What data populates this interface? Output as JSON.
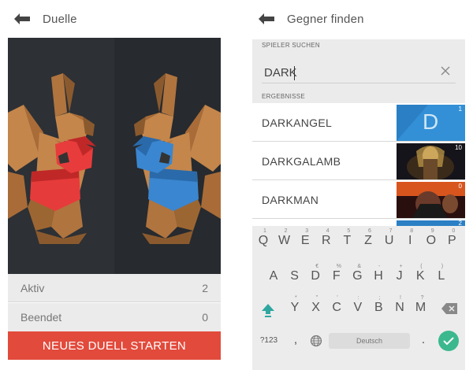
{
  "left_screen": {
    "title": "Duelle",
    "stats": [
      {
        "label": "Aktiv",
        "value": "2"
      },
      {
        "label": "Beendet",
        "value": "0"
      }
    ],
    "start_button": "NEUES DUELL STARTEN"
  },
  "right_screen": {
    "title": "Gegner finden",
    "search_section": "SPIELER SUCHEN",
    "search_value": "DARK",
    "results_section": "ERGEBNISSE",
    "results": [
      {
        "name": "DARKANGEL",
        "count": "1",
        "avatar_letter": "D"
      },
      {
        "name": "DARKGALAMB",
        "count": "10"
      },
      {
        "name": "DARKMAN",
        "count": "0"
      },
      {
        "name": "",
        "count": "2"
      }
    ]
  },
  "keyboard": {
    "row1": [
      {
        "k": "Q",
        "s": "1"
      },
      {
        "k": "W",
        "s": "2"
      },
      {
        "k": "E",
        "s": "3"
      },
      {
        "k": "R",
        "s": "4"
      },
      {
        "k": "T",
        "s": "5"
      },
      {
        "k": "Z",
        "s": "6"
      },
      {
        "k": "U",
        "s": "7"
      },
      {
        "k": "I",
        "s": "8"
      },
      {
        "k": "O",
        "s": "9"
      },
      {
        "k": "P",
        "s": "0"
      }
    ],
    "row2": [
      {
        "k": "A",
        "s": ""
      },
      {
        "k": "S",
        "s": ""
      },
      {
        "k": "D",
        "s": "€"
      },
      {
        "k": "F",
        "s": "%"
      },
      {
        "k": "G",
        "s": "&"
      },
      {
        "k": "H",
        "s": "-"
      },
      {
        "k": "J",
        "s": "+"
      },
      {
        "k": "K",
        "s": "("
      },
      {
        "k": "L",
        "s": ")"
      }
    ],
    "row3": [
      {
        "k": "Y",
        "s": "*"
      },
      {
        "k": "X",
        "s": "\""
      },
      {
        "k": "C",
        "s": "'"
      },
      {
        "k": "V",
        "s": ":"
      },
      {
        "k": "B",
        "s": ";"
      },
      {
        "k": "N",
        "s": "!"
      },
      {
        "k": "M",
        "s": "?"
      }
    ],
    "symbols_key": "?123",
    "comma_key": ",",
    "space_label": "Deutsch",
    "period_key": "."
  },
  "colors": {
    "accent_red": "#e24a3b",
    "enter_green": "#3cb88e",
    "avatar_blue": "#2b7fc4",
    "arena_bg": "#2d3035"
  }
}
